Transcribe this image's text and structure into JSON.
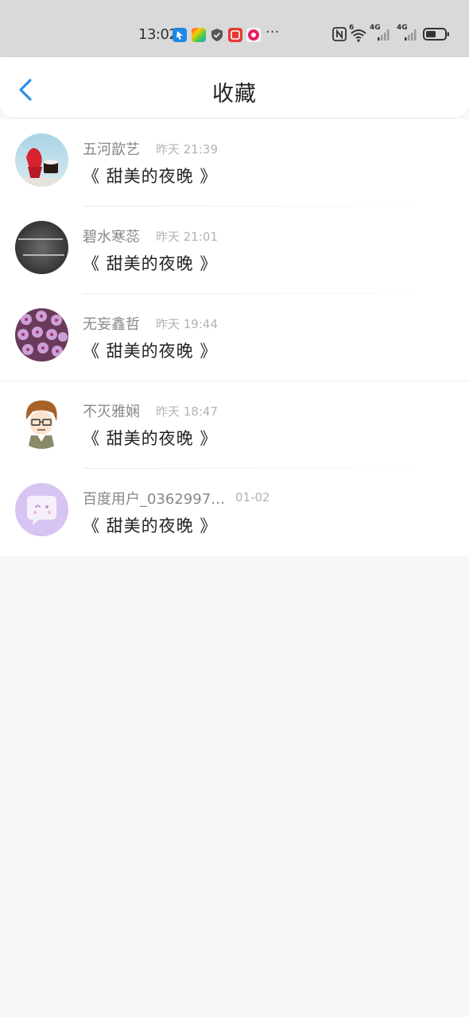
{
  "status_bar": {
    "time": "13:02",
    "network_1": "6",
    "network_2": "4G",
    "network_3": "4G",
    "overflow": "···"
  },
  "header": {
    "title": "收藏",
    "back_icon": "chevron-left-icon"
  },
  "favorites": [
    {
      "name": "五河歆艺",
      "time": "昨天 21:39",
      "content": "《 甜美的夜晚 》",
      "avatar": "ice-cream-photo"
    },
    {
      "name": "碧水寒蕊",
      "time": "昨天 21:01",
      "content": "《 甜美的夜晚 》",
      "avatar": "dark-text-photo"
    },
    {
      "name": "无妄鑫哲",
      "time": "昨天 19:44",
      "content": "《 甜美的夜晚 》",
      "avatar": "purple-flowers-photo"
    },
    {
      "name": "不灭雅娴",
      "time": "昨天 18:47",
      "content": "《 甜美的夜晚 》",
      "avatar": "cartoon-boy"
    },
    {
      "name": "百度用户_03629979…",
      "time": "01-02",
      "content": "《 甜美的夜晚 》",
      "avatar": "chat-bubble-default"
    }
  ],
  "colors": {
    "accent": "#2b8fe8",
    "background": "#f8f7f7",
    "status_bar": "#d9d9d9"
  }
}
